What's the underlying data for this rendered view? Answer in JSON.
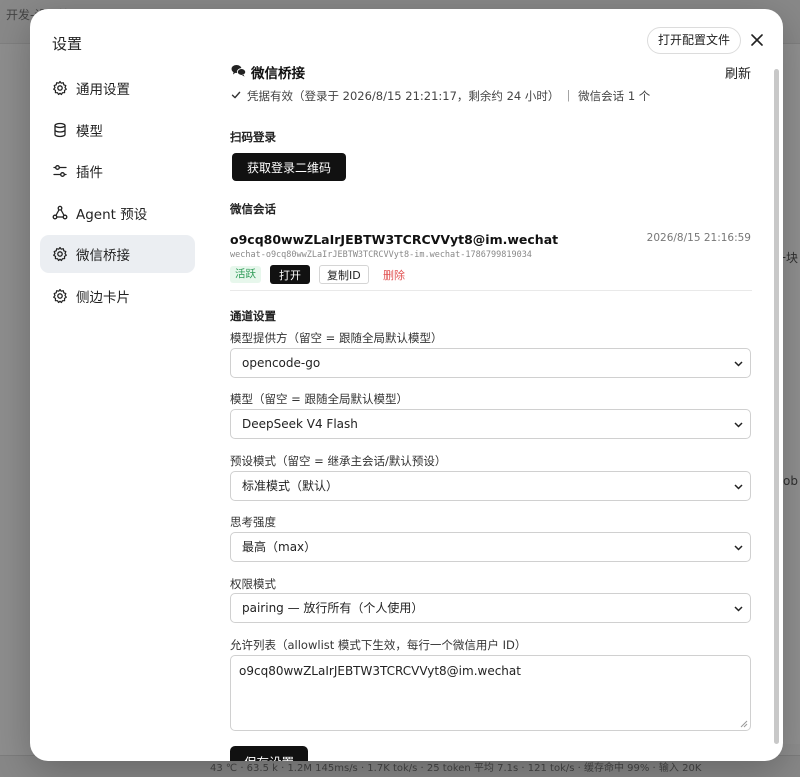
{
  "background": {
    "top_text": "开发-设置管理",
    "right_text_1": "一块",
    "right_text_2": "ob",
    "status_text": "43 ℃ · 63.5 k · 1.2M 145ms/s · 1.7K tok/s · 25 token 平均 7.1s · 121 tok/s · 缓存命中 99% · 输入 20K"
  },
  "modal": {
    "title": "设置",
    "open_config_label": "打开配置文件"
  },
  "sidebar": {
    "items": [
      {
        "label": "通用设置",
        "icon": "gear-icon"
      },
      {
        "label": "模型",
        "icon": "database-icon"
      },
      {
        "label": "插件",
        "icon": "sliders-icon"
      },
      {
        "label": "Agent 预设",
        "icon": "agent-icon"
      },
      {
        "label": "微信桥接",
        "icon": "gear-icon",
        "active": true
      },
      {
        "label": "侧边卡片",
        "icon": "gear-icon"
      }
    ]
  },
  "content": {
    "title": "微信桥接",
    "refresh_label": "刷新",
    "credential_text": "凭据有效（登录于 2026/8/15 21:21:17，剩余约 24 小时） ｜ 微信会话 1 个",
    "scan_section_label": "扫码登录",
    "qr_button_label": "获取登录二维码",
    "session_section_label": "微信会话",
    "session": {
      "id": "o9cq80wwZLaIrJEBTW3TCRCVVyt8@im.wechat",
      "time": "2026/8/15 21:16:59",
      "sub_id": "wechat-o9cq80wwZLaIrJEBTW3TCRCVVyt8-im.wechat-1786799819034",
      "status_badge": "活跃",
      "open_label": "打开",
      "copy_label": "复制ID",
      "delete_label": "删除"
    },
    "channel_section_label": "通道设置",
    "fields": {
      "provider": {
        "label": "模型提供方（留空 = 跟随全局默认模型）",
        "value": "opencode-go"
      },
      "model": {
        "label": "模型（留空 = 跟随全局默认模型）",
        "value": "DeepSeek V4 Flash"
      },
      "preset": {
        "label": "预设模式（留空 = 继承主会话/默认预设）",
        "value": "标准模式（默认）"
      },
      "thinking": {
        "label": "思考强度",
        "value": "最高（max）"
      },
      "permission": {
        "label": "权限模式",
        "value": "pairing — 放行所有（个人使用）"
      },
      "allowlist": {
        "label": "允许列表（allowlist 模式下生效，每行一个微信用户 ID）",
        "value": "o9cq80wwZLaIrJEBTW3TCRCVVyt8@im.wechat"
      }
    },
    "save_label": "保存设置"
  },
  "colors": {
    "primary_button": "#111111",
    "active_badge_bg": "#e7f7ec",
    "active_badge_text": "#2e9b57",
    "delete_text": "#e05050",
    "sidebar_active_bg": "#ebeef2"
  }
}
